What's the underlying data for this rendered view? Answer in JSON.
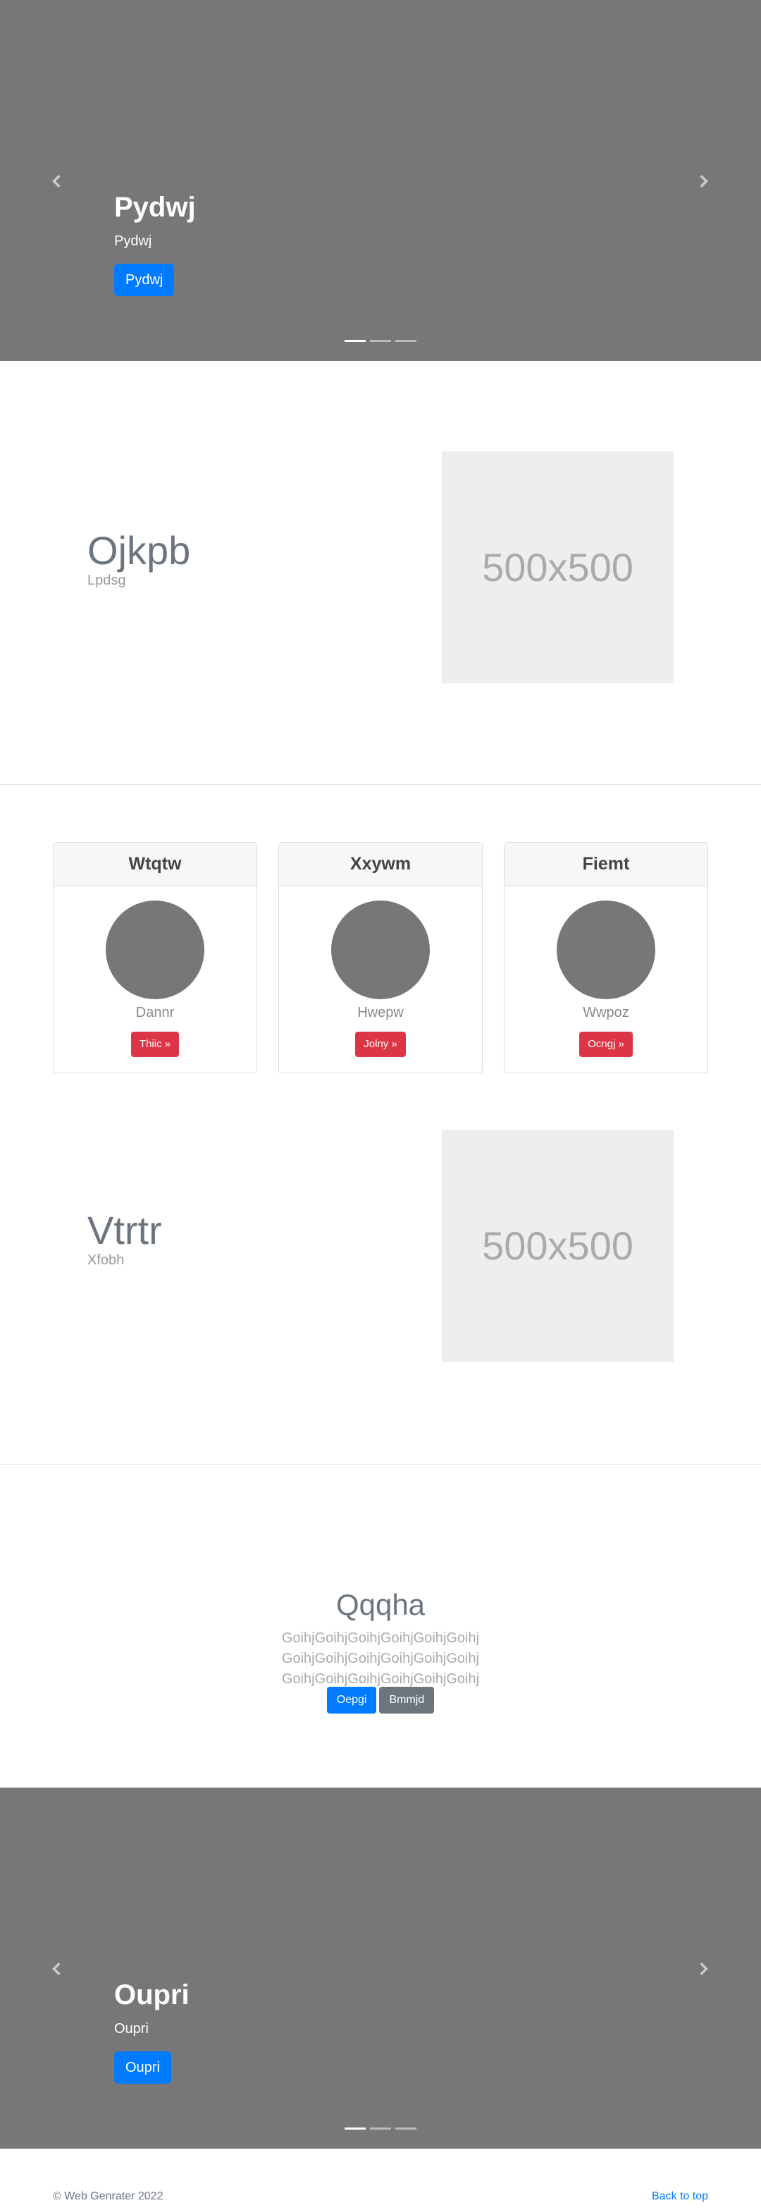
{
  "carousel_top": {
    "title": "Pydwj",
    "subtitle": "Pydwj",
    "button_label": "Pydwj",
    "prev_icon": "chevron-left-icon",
    "next_icon": "chevron-right-icon",
    "slide_count": 3,
    "active_slide": 1
  },
  "featurette_1": {
    "heading": "Ojkpb",
    "subtext": "Lpdsg",
    "image_placeholder": "500x500"
  },
  "cards": [
    {
      "header": "Wtqtw",
      "name": "Dannr",
      "button_label": "Thiic »"
    },
    {
      "header": "Xxywm",
      "name": "Hwepw",
      "button_label": "Jolny »"
    },
    {
      "header": "Fiemt",
      "name": "Wwpoz",
      "button_label": "Ocngj »"
    }
  ],
  "featurette_2": {
    "heading": "Vtrtr",
    "subtext": "Xfobh",
    "image_placeholder": "500x500"
  },
  "jumbotron": {
    "heading": "Qqqha",
    "lead": "GoihjGoihjGoihjGoihjGoihjGoihj GoihjGoihjGoihjGoihjGoihjGoihj GoihjGoihjGoihjGoihjGoihjGoihj",
    "primary_button": "Oepgi",
    "secondary_button": "Bmmjd"
  },
  "carousel_bottom": {
    "title": "Oupri",
    "subtitle": "Oupri",
    "button_label": "Oupri",
    "prev_icon": "chevron-left-icon",
    "next_icon": "chevron-right-icon",
    "slide_count": 3,
    "active_slide": 1
  },
  "footer": {
    "copyright": "© Web Genrater 2022",
    "back_to_top": "Back to top"
  },
  "colors": {
    "carousel_bg": "#777777",
    "primary": "#007bff",
    "danger": "#dc3545",
    "secondary": "#6c757d",
    "placeholder_bg": "#eeeeee"
  }
}
